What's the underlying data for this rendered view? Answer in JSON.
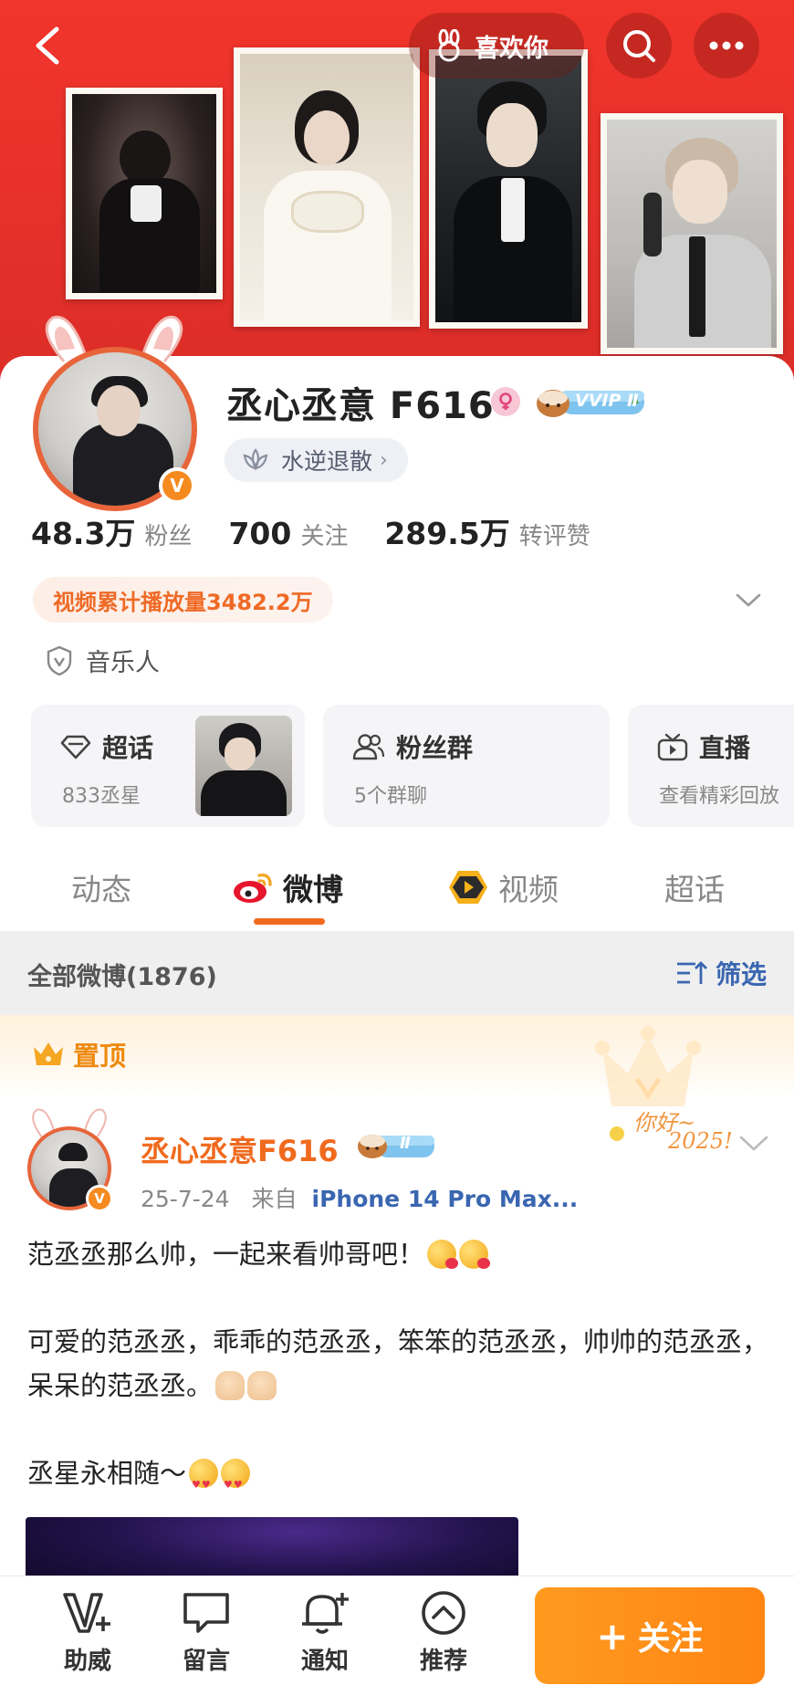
{
  "header": {
    "like_label": "喜欢你",
    "icons": [
      "back-icon",
      "bunny-icon",
      "search-icon",
      "more-icon"
    ]
  },
  "profile": {
    "name": "丞心丞意 F616",
    "vip_label": "VVIP Ⅱ",
    "group_label": "水逆退散",
    "stats": [
      {
        "num": "48.3万",
        "label": "粉丝"
      },
      {
        "num": "700",
        "label": "关注"
      },
      {
        "num": "289.5万",
        "label": "转评赞"
      }
    ],
    "plays_label": "视频累计播放量3482.2万",
    "role_label": "音乐人",
    "verified_badge": "V"
  },
  "features": [
    {
      "title": "超话",
      "sub": "833丞星"
    },
    {
      "title": "粉丝群",
      "sub": "5个群聊"
    },
    {
      "title": "直播",
      "sub": "查看精彩回放"
    }
  ],
  "tabs": [
    {
      "label": "动态"
    },
    {
      "label": "微博"
    },
    {
      "label": "视频"
    },
    {
      "label": "超话"
    }
  ],
  "filterbar": {
    "count_label": "全部微博(1876)",
    "filter_label": "筛选"
  },
  "pinned": {
    "label": "置顶",
    "newyear_line1": "你好~",
    "newyear_line2": "2025!"
  },
  "post": {
    "author": "丞心丞意F616",
    "level_label": "Ⅱ",
    "date": "25-7-24",
    "from_label": "来自",
    "source": "iPhone 14 Pro Max...",
    "para1": "范丞丞那么帅，一起来看帅哥吧！",
    "para2": "可爱的范丞丞，乖乖的范丞丞，笨笨的范丞丞，帅帅的范丞丞，呆呆的范丞丞。",
    "para3": "丞星永相随～"
  },
  "bottombar": {
    "items": [
      {
        "label": "助威"
      },
      {
        "label": "留言"
      },
      {
        "label": "通知"
      },
      {
        "label": "推荐"
      }
    ],
    "follow_label": "关注"
  },
  "colors": {
    "banner": "#e5302a",
    "accent_orange": "#f06a1e",
    "link_blue": "#3a66b0",
    "follow_button": "#ff8f18"
  }
}
